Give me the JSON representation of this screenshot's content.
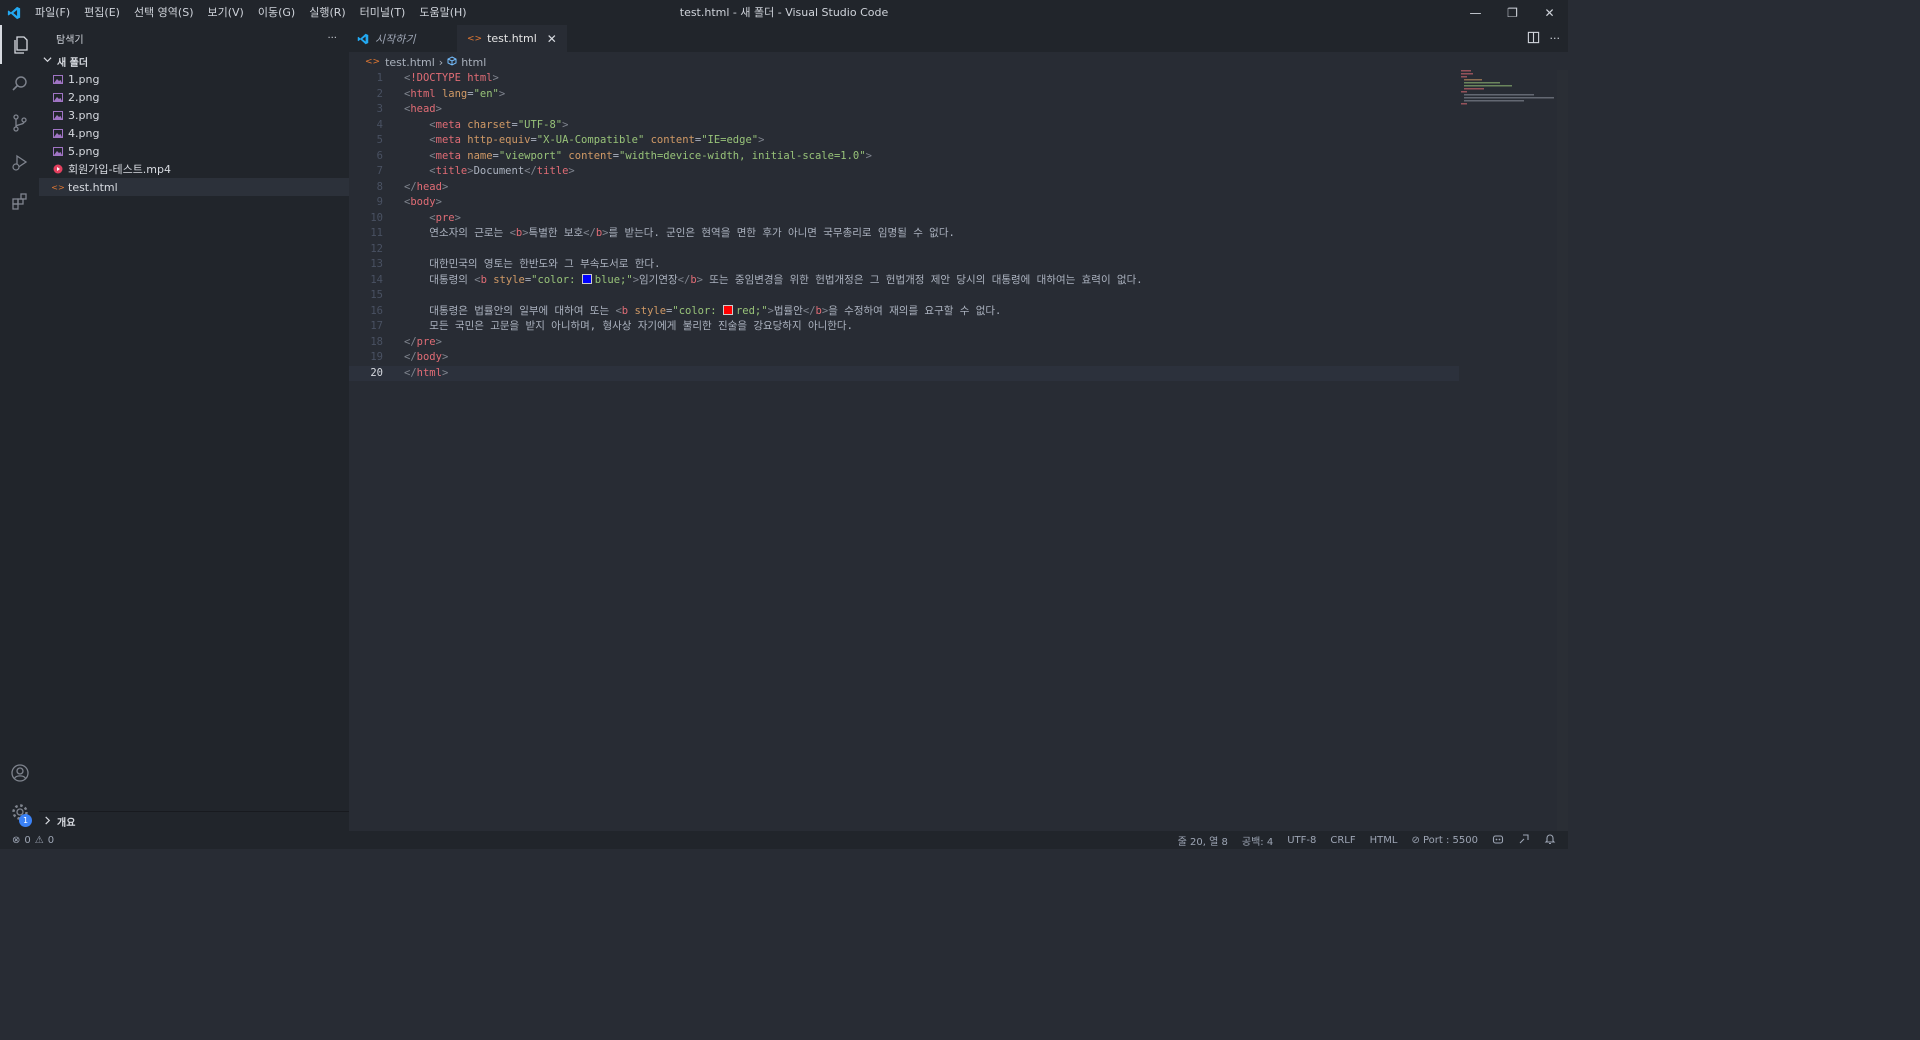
{
  "window": {
    "title": "test.html - 새 폴더 - Visual Studio Code"
  },
  "menu": [
    "파일(F)",
    "편집(E)",
    "선택 영역(S)",
    "보기(V)",
    "이동(G)",
    "실행(R)",
    "터미널(T)",
    "도움말(H)"
  ],
  "sidebar": {
    "header": "탐색기",
    "more": "···",
    "folder": "새 폴더",
    "files": [
      {
        "name": "1.png",
        "type": "image"
      },
      {
        "name": "2.png",
        "type": "image"
      },
      {
        "name": "3.png",
        "type": "image"
      },
      {
        "name": "4.png",
        "type": "image"
      },
      {
        "name": "5.png",
        "type": "image"
      },
      {
        "name": "회원가입-테스트.mp4",
        "type": "video"
      },
      {
        "name": "test.html",
        "type": "html"
      }
    ],
    "outline": "개요"
  },
  "tabs": [
    {
      "label": "시작하기"
    },
    {
      "label": "test.html"
    }
  ],
  "breadcrumb": {
    "file": "test.html",
    "symbol": "html"
  },
  "activity_badge": "1",
  "code_lines": [
    "<!DOCTYPE html>",
    "<html lang=\"en\">",
    "<head>",
    "    <meta charset=\"UTF-8\">",
    "    <meta http-equiv=\"X-UA-Compatible\" content=\"IE=edge\">",
    "    <meta name=\"viewport\" content=\"width=device-width, initial-scale=1.0\">",
    "    <title>Document</title>",
    "</head>",
    "<body>",
    "    <pre>",
    "    연소자의 근로는 <b>특별한 보호</b>를 받는다. 군인은 현역을 면한 후가 아니면 국무총리로 임명될 수 없다.",
    "",
    "    대한민국의 영토는 한반도와 그 부속도서로 한다.",
    "    대통령의 <b style=\"color: blue;\">임기연장</b> 또는 중임변경을 위한 헌법개정은 그 헌법개정 제안 당시의 대통령에 대하여는 효력이 없다.",
    "",
    "    대통령은 법률안의 일부에 대하여 또는 <b style=\"color: red;\">법률안</b>을 수정하여 재의를 요구할 수 없다.",
    "    모든 국민은 고문을 받지 아니하며, 형사상 자기에게 불리한 진술을 강요당하지 아니한다.",
    "</pre>",
    "</body>",
    "</html>"
  ],
  "current_line": 20,
  "status": {
    "errors": "0",
    "warnings": "0",
    "position": "줄 20, 열 8",
    "spaces": "공백: 4",
    "encoding": "UTF-8",
    "eol": "CRLF",
    "language": "HTML",
    "port": "Port : 5500"
  },
  "colors": {
    "accent": "#007acc",
    "tag": "#e06c75",
    "attr": "#d19a66",
    "string": "#98c379"
  }
}
